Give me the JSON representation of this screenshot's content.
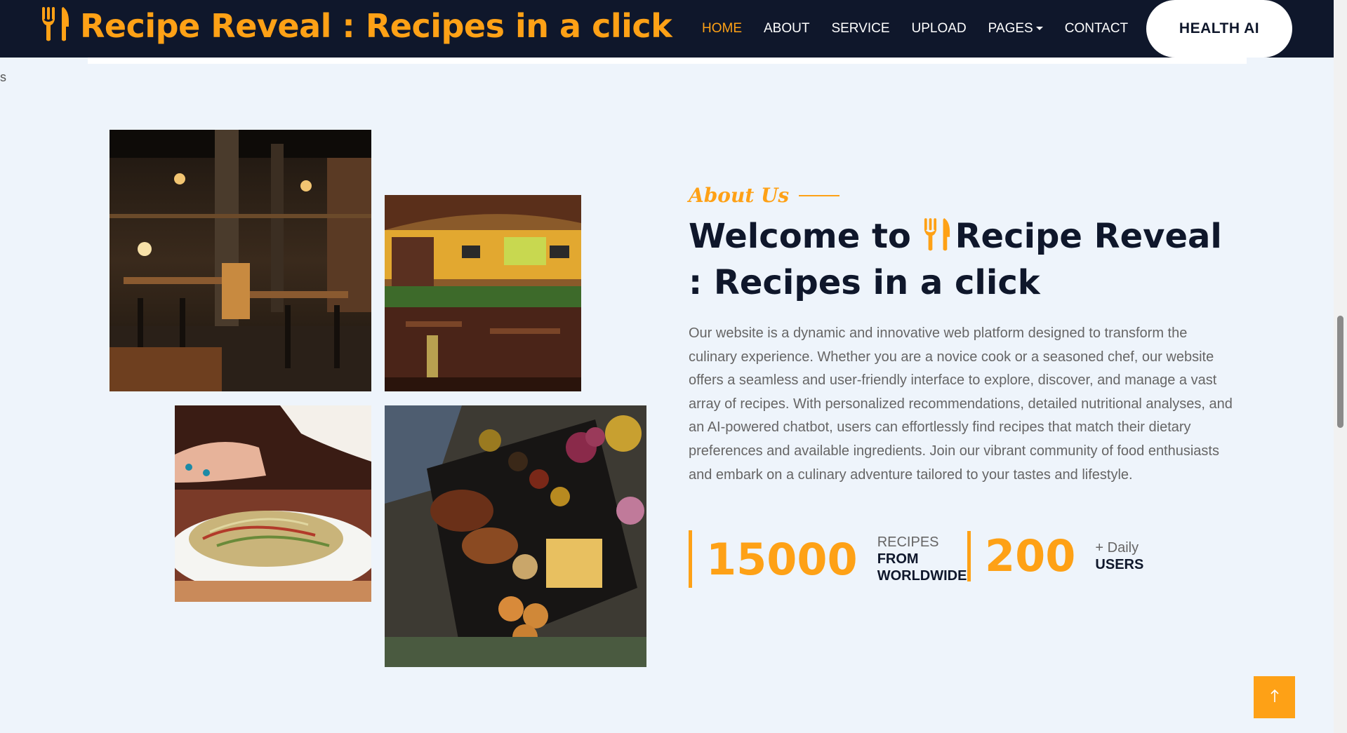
{
  "brand": {
    "title": "Recipe Reveal : Recipes in a click",
    "icon": "fork-knife-icon",
    "color": "#fea116"
  },
  "nav": {
    "items": [
      {
        "label": "HOME",
        "active": true
      },
      {
        "label": "ABOUT"
      },
      {
        "label": "SERVICE"
      },
      {
        "label": "UPLOAD"
      },
      {
        "label": "PAGES",
        "dropdown": true
      },
      {
        "label": "CONTACT"
      }
    ],
    "cta": "HEALTH AI"
  },
  "stray_text": "s",
  "images": [
    {
      "name": "restaurant-interior-dark-photo"
    },
    {
      "name": "restaurant-dining-room-photo"
    },
    {
      "name": "salad-plate-photo"
    },
    {
      "name": "food-platter-photo"
    }
  ],
  "about": {
    "tag": "About Us",
    "headline_prefix": "Welcome to",
    "headline_brand": "Recipe Reveal : Recipes in a click",
    "paragraph": "Our website is a dynamic and innovative web platform designed to transform the culinary experience. Whether you are a novice cook or a seasoned chef, our website offers a seamless and user-friendly interface to explore, discover, and manage a vast array of recipes. With personalized recommendations, detailed nutritional analyses, and an AI-powered chatbot, users can effortlessly find recipes that match their dietary preferences and available ingredients. Join our vibrant community of food enthusiasts and embark on a culinary adventure tailored to your tastes and lifestyle."
  },
  "stats": [
    {
      "number": "15000",
      "line1": "RECIPES",
      "line2": "FROM WORLDWIDE"
    },
    {
      "number": "200",
      "line1": "+ Daily",
      "line2": "USERS"
    }
  ],
  "colors": {
    "accent": "#fea116",
    "dark": "#0f172b",
    "background": "#eef4fb"
  },
  "back_to_top_icon": "arrow-up-icon"
}
